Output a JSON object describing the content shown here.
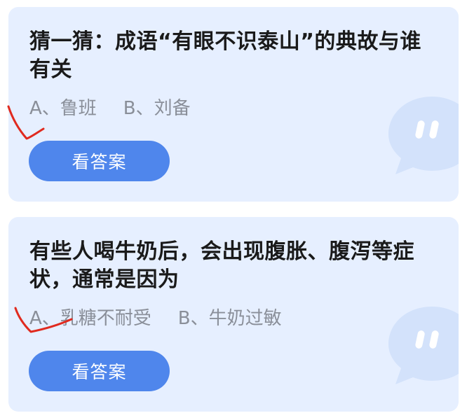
{
  "quiz_cards": [
    {
      "question": "猜一猜：成语“有眼不识泰山”的典故与谁有关",
      "options": [
        {
          "label": "A、鲁班"
        },
        {
          "label": "B、刘备"
        }
      ],
      "button_label": "看答案",
      "marked_option": "A"
    },
    {
      "question": "有些人喝牛奶后，会出现腹胀、腹泻等症状，通常是因为",
      "options": [
        {
          "label": "A、乳糖不耐受"
        },
        {
          "label": "B、牛奶过敏"
        }
      ],
      "button_label": "看答案",
      "marked_option": "A"
    }
  ],
  "colors": {
    "card_background": "#e6efff",
    "button": "#4f86ec",
    "question_text": "#1a1a1a",
    "option_text": "#8a8f99",
    "annotation_mark": "#e02a1f",
    "decor_icon": "#d3e2fb"
  }
}
